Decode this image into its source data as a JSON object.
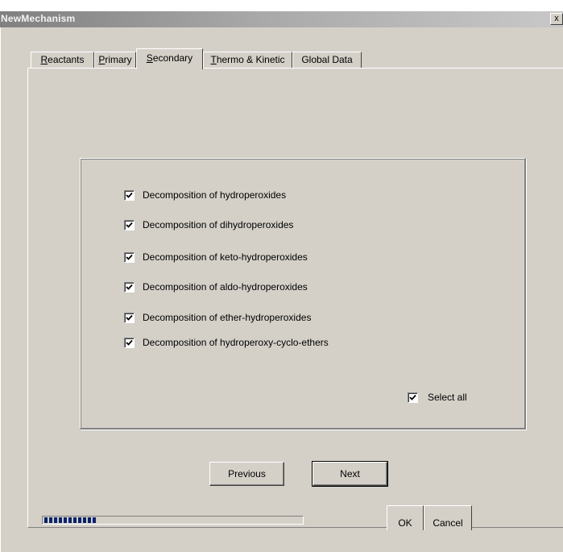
{
  "window": {
    "title": "NewMechanism",
    "close_glyph": "x"
  },
  "tabs": [
    {
      "label": "Reactants",
      "mnemonic": "R",
      "rest": "eactants"
    },
    {
      "label": "Primary",
      "mnemonic": "P",
      "rest": "rimary"
    },
    {
      "label": "Secondary",
      "mnemonic": "S",
      "rest": "econdary",
      "active": true
    },
    {
      "label": "Thermo & Kinetic",
      "mnemonic": "T",
      "rest": "hermo & Kinetic"
    },
    {
      "label": "Global Data",
      "mnemonic": "",
      "rest": "Global Data"
    }
  ],
  "options": [
    {
      "label": "Decomposition of hydroperoxides",
      "checked": true
    },
    {
      "label": "Decomposition of dihydroperoxides",
      "checked": true
    },
    {
      "label": "Decomposition of keto-hydroperoxides",
      "checked": true
    },
    {
      "label": "Decomposition of aldo-hydroperoxides",
      "checked": true
    },
    {
      "label": "Decomposition of ether-hydroperoxides",
      "checked": true
    },
    {
      "label": "Decomposition of hydroperoxy-cyclo-ethers",
      "checked": true
    }
  ],
  "select_all": {
    "label": "Select all",
    "checked": true
  },
  "buttons": {
    "previous": "Previous",
    "next": "Next",
    "ok": "OK",
    "cancel": "Cancel"
  },
  "progress": {
    "fraction": 0.2
  },
  "icons": {
    "close": "close-icon",
    "check": "checkmark-icon"
  }
}
